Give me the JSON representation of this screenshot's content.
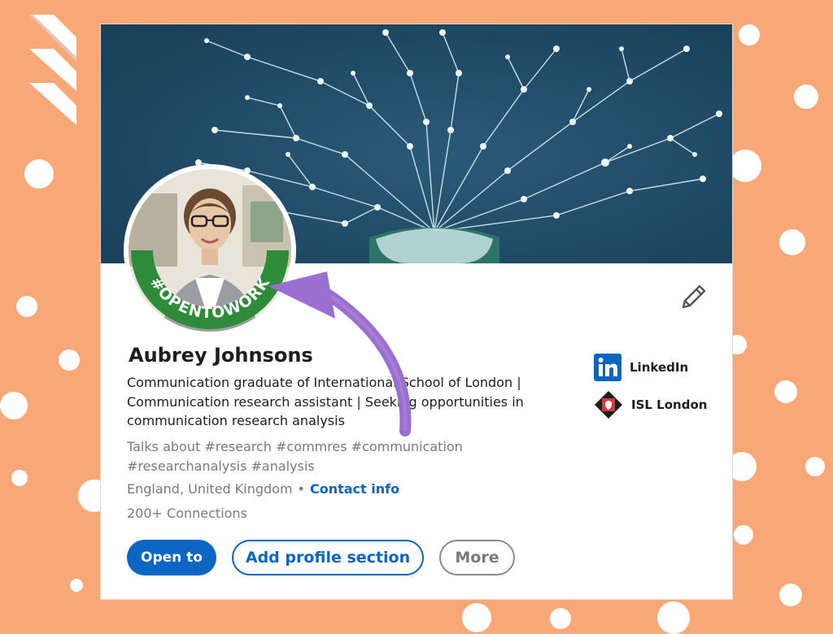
{
  "profile": {
    "name": "Aubrey Johnsons",
    "headline": "Communication graduate of International School of London | Communication research assistant | Seeking opportunities in communication research analysis",
    "talks_about": "Talks about #research #commres #communication #researchanalysis #analysis",
    "location": "England, United Kingdom",
    "separator": "•",
    "contact_label": "Contact info",
    "connections": "200+ Connections",
    "open_to_work_badge": "#OPENTOWORK"
  },
  "actions": {
    "open_to": "Open to",
    "add_section": "Add profile section",
    "more": "More"
  },
  "companies": [
    {
      "label": "LinkedIn",
      "icon": "linkedin-logo-icon"
    },
    {
      "label": "ISL London",
      "icon": "isl-london-logo-icon"
    }
  ],
  "icons": {
    "edit": "pencil-icon",
    "annotation": "curved-arrow-icon",
    "brand": "stripes-logo-icon"
  },
  "colors": {
    "background": "#f8a877",
    "banner": "#1d4763",
    "accent_blue": "#0a66c2",
    "open_to_work_green": "#2e8b3a",
    "arrow_purple": "#9b6fd0"
  }
}
